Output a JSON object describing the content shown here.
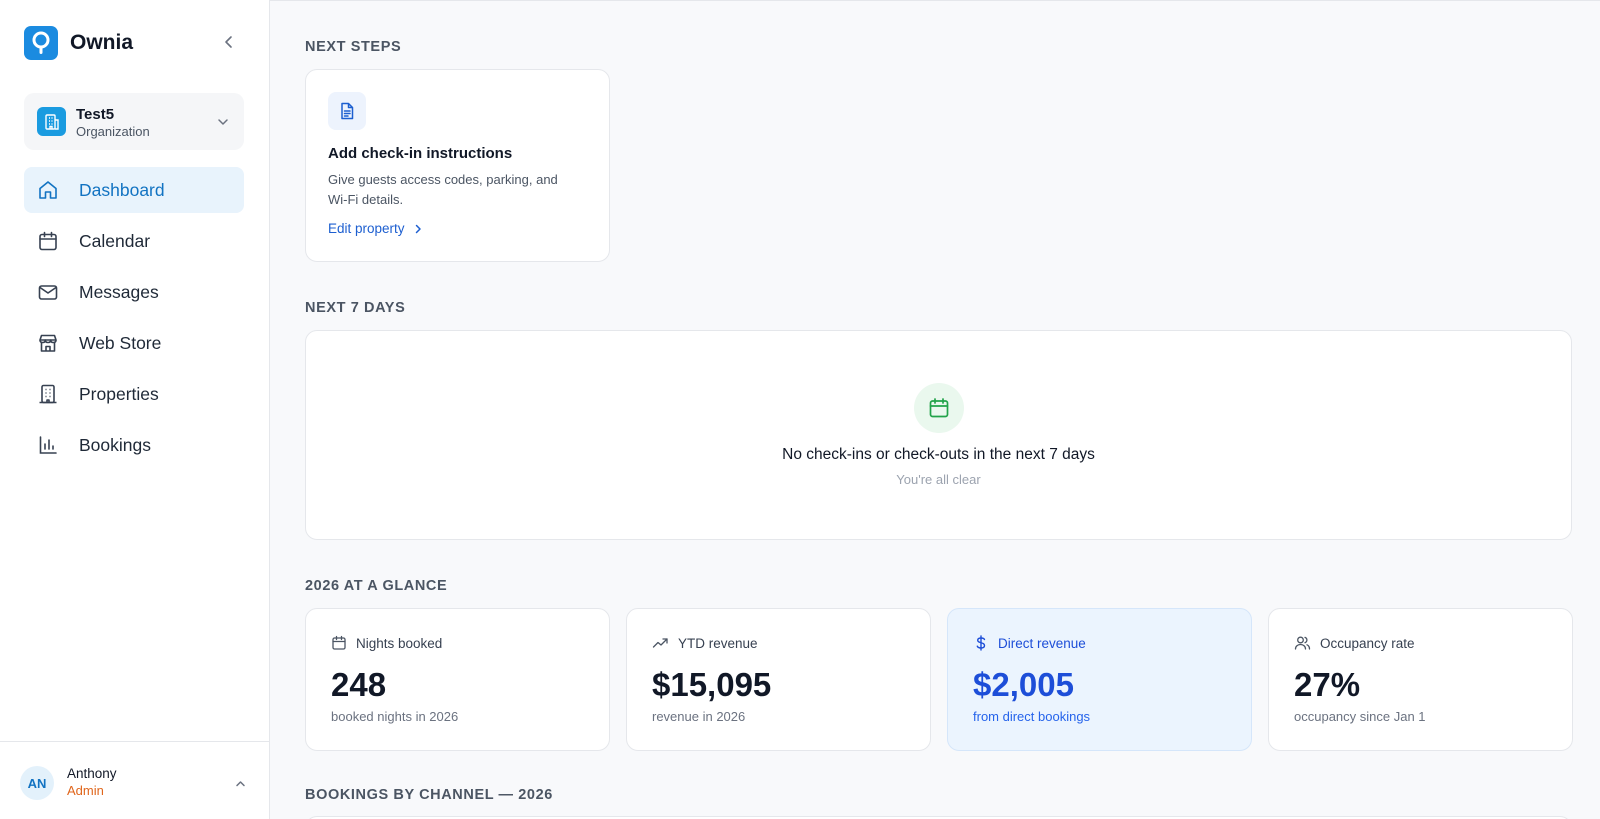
{
  "brand": {
    "name": "Ownia",
    "color": "#1b8be0"
  },
  "org": {
    "name": "Test5",
    "type": "Organization"
  },
  "nav": {
    "items": [
      {
        "label": "Dashboard",
        "icon": "home-icon",
        "active": true
      },
      {
        "label": "Calendar",
        "icon": "calendar-icon"
      },
      {
        "label": "Messages",
        "icon": "mail-icon"
      },
      {
        "label": "Web Store",
        "icon": "store-icon"
      },
      {
        "label": "Properties",
        "icon": "building-icon"
      },
      {
        "label": "Bookings",
        "icon": "bar-chart-icon"
      }
    ]
  },
  "user": {
    "initials": "AN",
    "name": "Anthony",
    "role": "Admin"
  },
  "next_steps": {
    "title": "NEXT STEPS",
    "card": {
      "icon": "document-icon",
      "title": "Add check-in instructions",
      "description": "Give guests access codes, parking, and Wi-Fi details.",
      "link": "Edit property"
    }
  },
  "next_7_days": {
    "title": "NEXT 7 DAYS",
    "empty_title": "No check-ins or check-outs in the next 7 days",
    "empty_sub": "You're all clear"
  },
  "glance": {
    "title": "2026 AT A GLANCE",
    "stats": [
      {
        "label": "Nights booked",
        "icon": "calendar-icon",
        "value": "248",
        "sub": "booked nights in 2026"
      },
      {
        "label": "YTD revenue",
        "icon": "trending-up-icon",
        "value": "$15,095",
        "sub": "revenue in 2026"
      },
      {
        "label": "Direct revenue",
        "icon": "dollar-icon",
        "value": "$2,005",
        "sub": "from direct bookings",
        "highlight": true
      },
      {
        "label": "Occupancy rate",
        "icon": "users-icon",
        "value": "27%",
        "sub": "occupancy since Jan 1"
      }
    ]
  },
  "channel": {
    "title": "BOOKINGS BY CHANNEL — 2026"
  }
}
